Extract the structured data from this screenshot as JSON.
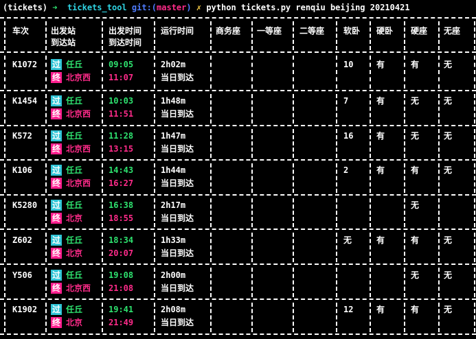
{
  "prompt": {
    "env": "(tickets)",
    "arrow": "➜",
    "dir": "tickets_tool",
    "git_label": "git:",
    "branch": "master",
    "x_mark": "✗",
    "command": "python tickets.py renqiu beijing 20210421"
  },
  "headers": [
    {
      "line1": "车次",
      "line2": ""
    },
    {
      "line1": "出发站",
      "line2": "到达站"
    },
    {
      "line1": "出发时间",
      "line2": "到达时间"
    },
    {
      "line1": "运行时间",
      "line2": ""
    },
    {
      "line1": "商务座",
      "line2": ""
    },
    {
      "line1": "一等座",
      "line2": ""
    },
    {
      "line1": "二等座",
      "line2": ""
    },
    {
      "line1": "软卧",
      "line2": ""
    },
    {
      "line1": "硬卧",
      "line2": ""
    },
    {
      "line1": "硬座",
      "line2": ""
    },
    {
      "line1": "无座",
      "line2": ""
    }
  ],
  "badges": {
    "pass": "过",
    "end": "终"
  },
  "rows": [
    {
      "train": "K1072",
      "from": "任丘",
      "to": "北京西",
      "dep": "09:05",
      "arr": "11:07",
      "duration": "2h02m",
      "arrival_day": "当日到达",
      "soft_sleeper": "10",
      "hard_sleeper": "有",
      "hard_seat": "有",
      "no_seat": "无"
    },
    {
      "train": "K1454",
      "from": "任丘",
      "to": "北京西",
      "dep": "10:03",
      "arr": "11:51",
      "duration": "1h48m",
      "arrival_day": "当日到达",
      "soft_sleeper": "7",
      "hard_sleeper": "有",
      "hard_seat": "无",
      "no_seat": "无"
    },
    {
      "train": "K572",
      "from": "任丘",
      "to": "北京西",
      "dep": "11:28",
      "arr": "13:15",
      "duration": "1h47m",
      "arrival_day": "当日到达",
      "soft_sleeper": "16",
      "hard_sleeper": "有",
      "hard_seat": "无",
      "no_seat": "无"
    },
    {
      "train": "K106",
      "from": "任丘",
      "to": "北京西",
      "dep": "14:43",
      "arr": "16:27",
      "duration": "1h44m",
      "arrival_day": "当日到达",
      "soft_sleeper": "2",
      "hard_sleeper": "有",
      "hard_seat": "有",
      "no_seat": "无"
    },
    {
      "train": "K5280",
      "from": "任丘",
      "to": "北京",
      "dep": "16:38",
      "arr": "18:55",
      "duration": "2h17m",
      "arrival_day": "当日到达",
      "soft_sleeper": "",
      "hard_sleeper": "",
      "hard_seat": "无",
      "no_seat": ""
    },
    {
      "train": "Z602",
      "from": "任丘",
      "to": "北京",
      "dep": "18:34",
      "arr": "20:07",
      "duration": "1h33m",
      "arrival_day": "当日到达",
      "soft_sleeper": "无",
      "hard_sleeper": "有",
      "hard_seat": "有",
      "no_seat": "无"
    },
    {
      "train": "Y506",
      "from": "任丘",
      "to": "北京西",
      "dep": "19:08",
      "arr": "21:08",
      "duration": "2h00m",
      "arrival_day": "当日到达",
      "soft_sleeper": "",
      "hard_sleeper": "",
      "hard_seat": "无",
      "no_seat": "无"
    },
    {
      "train": "K1902",
      "from": "任丘",
      "to": "北京",
      "dep": "19:41",
      "arr": "21:49",
      "duration": "2h08m",
      "arrival_day": "当日到达",
      "soft_sleeper": "12",
      "hard_sleeper": "有",
      "hard_seat": "有",
      "no_seat": "无"
    }
  ]
}
